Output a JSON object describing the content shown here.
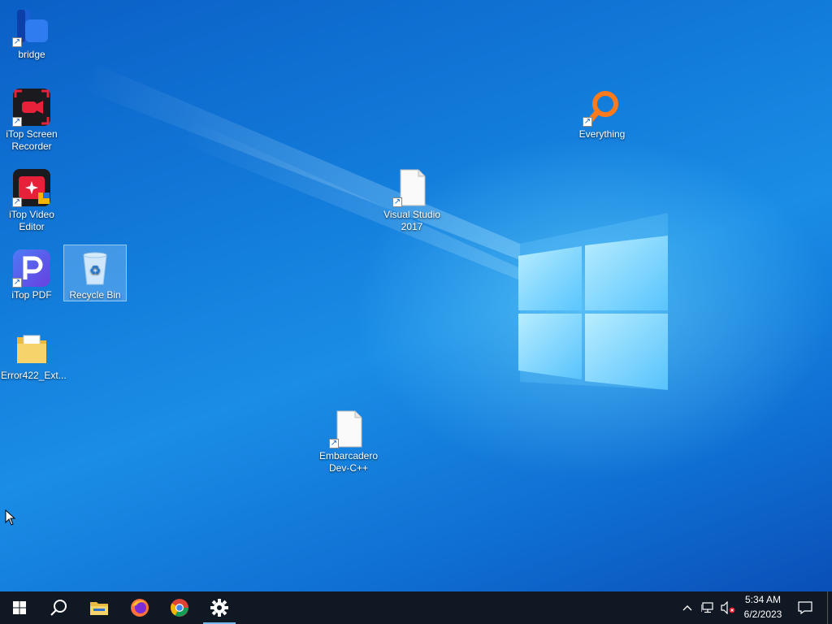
{
  "desktop": {
    "icons": [
      {
        "label": "bridge",
        "icon": "bridge-app-icon"
      },
      {
        "label": "iTop Screen Recorder",
        "icon": "itop-screen-recorder-icon"
      },
      {
        "label": "iTop Video Editor",
        "icon": "itop-video-editor-icon"
      },
      {
        "label": "iTop PDF",
        "icon": "itop-pdf-icon"
      },
      {
        "label": "Recycle Bin",
        "icon": "recycle-bin-icon"
      },
      {
        "label": "Error422_Ext...",
        "icon": "folder-icon"
      },
      {
        "label": "Visual Studio 2017",
        "icon": "blank-file-icon"
      },
      {
        "label": "Everything",
        "icon": "everything-search-icon"
      },
      {
        "label": "Embarcadero Dev-C++",
        "icon": "blank-file-icon"
      }
    ],
    "background": "windows-10-hero-wallpaper"
  },
  "taskbar": {
    "buttons": [
      {
        "name": "start",
        "icon": "windows-logo-icon"
      },
      {
        "name": "search",
        "icon": "search-icon"
      },
      {
        "name": "file-explorer",
        "icon": "folder-icon"
      },
      {
        "name": "firefox",
        "icon": "firefox-icon"
      },
      {
        "name": "chrome",
        "icon": "chrome-icon"
      },
      {
        "name": "settings",
        "icon": "gear-icon",
        "active": true
      }
    ],
    "tray": {
      "time": "5:34 AM",
      "date": "6/2/2023",
      "icons": [
        "chevron-up-icon",
        "network-icon",
        "volume-muted-icon",
        "notification-icon"
      ]
    }
  },
  "colors": {
    "taskbar": "#0f1823",
    "accent": "#76b9ed",
    "desktop_blue": "#1178d8"
  }
}
